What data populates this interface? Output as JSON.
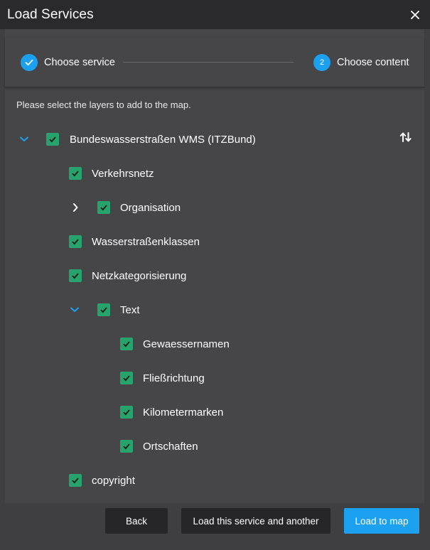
{
  "dialog": {
    "title": "Load Services",
    "close_icon": "close-icon"
  },
  "stepper": {
    "steps": [
      {
        "label": "Choose service",
        "state": "completed",
        "icon": "check-icon"
      },
      {
        "label": "Choose content",
        "state": "active",
        "number": "2"
      }
    ]
  },
  "instruction": "Please select the layers to add to the map.",
  "tree": {
    "root": {
      "label": "Bundeswasserstraßen WMS (ITZBund)",
      "checked": true,
      "expanded": true,
      "action_icon": "sort-arrows-icon"
    },
    "items": [
      {
        "label": "Verkehrsnetz",
        "checked": true
      },
      {
        "label": "Organisation",
        "checked": true,
        "expandable": true,
        "expanded": false
      },
      {
        "label": "Wasserstraßenklassen",
        "checked": true
      },
      {
        "label": "Netzkategorisierung",
        "checked": true
      },
      {
        "label": "Text",
        "checked": true,
        "expandable": true,
        "expanded": true
      },
      {
        "label": "Gewaessernamen",
        "checked": true
      },
      {
        "label": "Fließrichtung",
        "checked": true
      },
      {
        "label": "Kilometermarken",
        "checked": true
      },
      {
        "label": "Ortschaften",
        "checked": true
      },
      {
        "label": "copyright",
        "checked": true
      }
    ]
  },
  "footer": {
    "back_label": "Back",
    "another_label": "Load this service and another",
    "load_label": "Load to map"
  },
  "colors": {
    "accent": "#1ca0f0",
    "checkbox": "#26a36a",
    "titlebar": "#2a2a2c",
    "panel": "#464648"
  }
}
